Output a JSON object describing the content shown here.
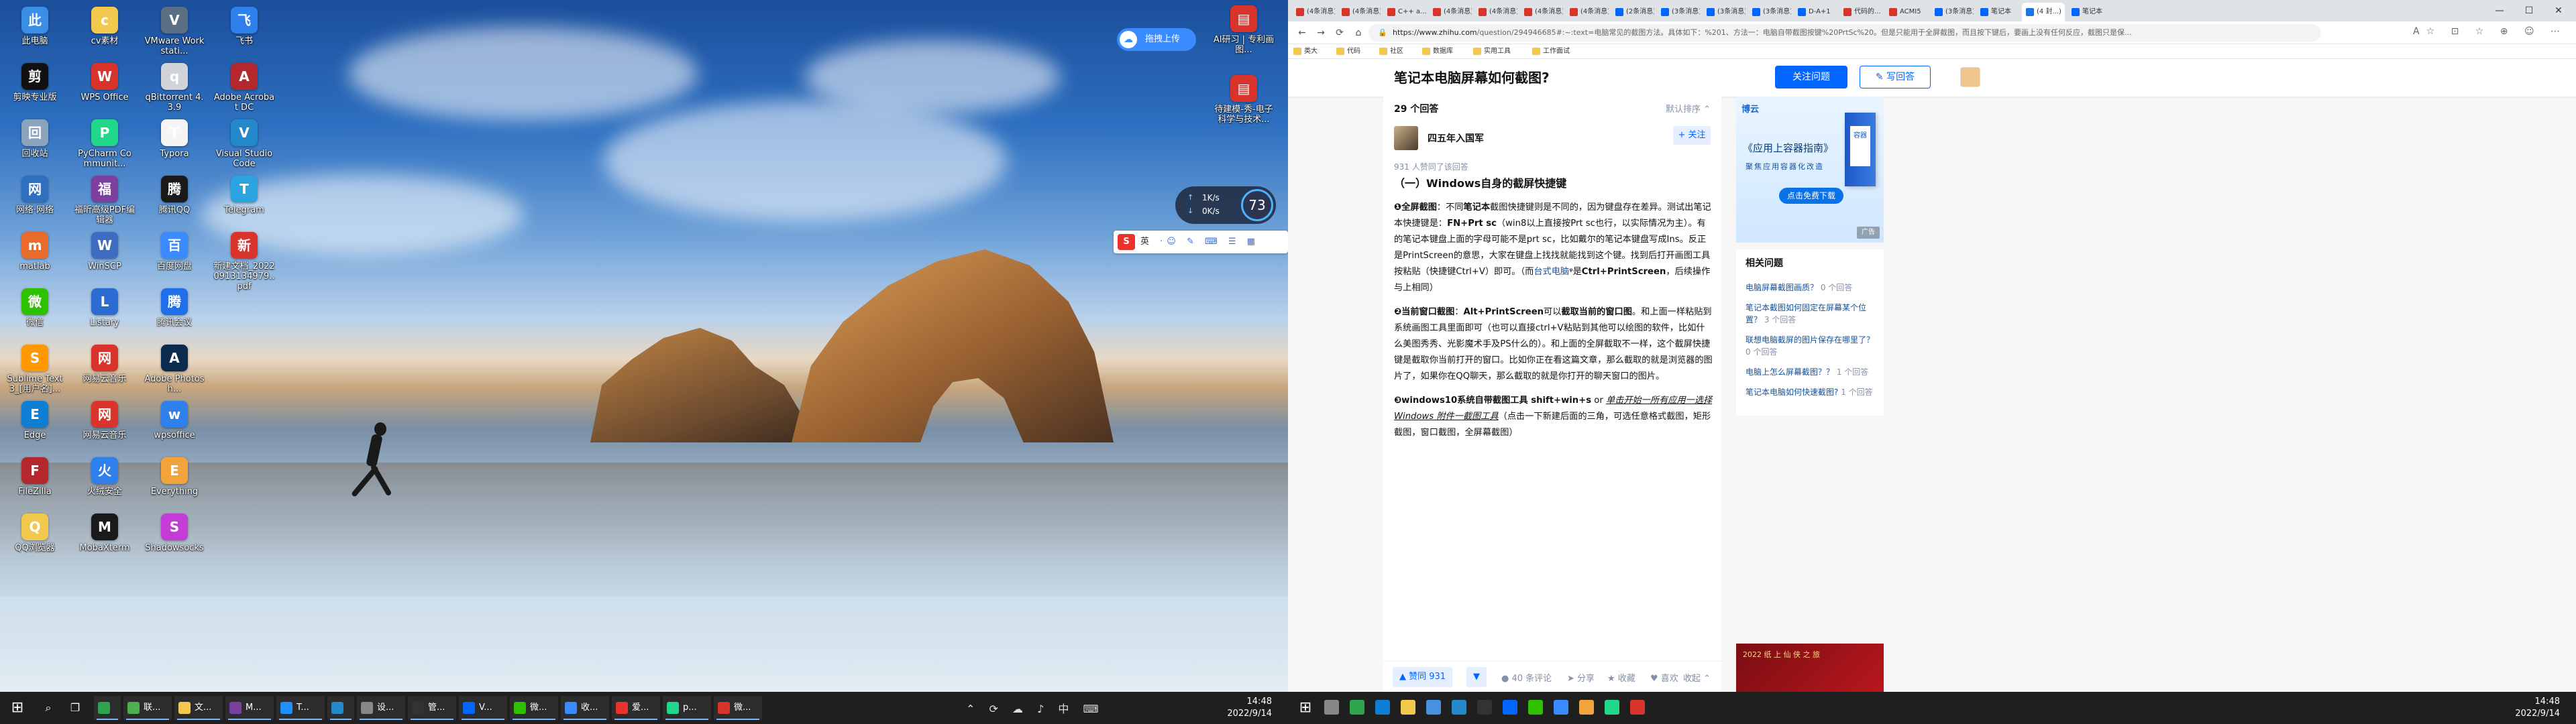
{
  "left_screen": {
    "desktop_icons": [
      {
        "label": "此电脑",
        "icon": "computer-icon",
        "color": "#3a8ee6"
      },
      {
        "label": "cv素材",
        "icon": "folder-icon",
        "color": "#f2c94c"
      },
      {
        "label": "VMware Workstati...",
        "icon": "vmware-icon",
        "color": "#5a6f84"
      },
      {
        "label": "飞书",
        "icon": "feishu-icon",
        "color": "#2f80ed"
      },
      {
        "label": "剪映专业版",
        "icon": "jianying-icon",
        "color": "#111111"
      },
      {
        "label": "WPS Office",
        "icon": "wps-icon",
        "color": "#d8342c"
      },
      {
        "label": "qBittorrent 4.3.9",
        "icon": "qbittorrent-icon",
        "color": "#d0d4d8"
      },
      {
        "label": "Adobe Acrobat DC",
        "icon": "acrobat-icon",
        "color": "#b3282d"
      },
      {
        "label": "回收站",
        "icon": "recycle-bin-icon",
        "color": "#8aa4bd"
      },
      {
        "label": "PyCharm Communit...",
        "icon": "pycharm-icon",
        "color": "#21d789"
      },
      {
        "label": "Typora",
        "icon": "typora-icon",
        "color": "#f5f5f5"
      },
      {
        "label": "Visual Studio Code",
        "icon": "vscode-icon",
        "color": "#2489ca"
      },
      {
        "label": "网络·网络",
        "icon": "network-icon",
        "color": "#2f6fc0"
      },
      {
        "label": "福昕高级PDF编辑器",
        "icon": "foxit-icon",
        "color": "#7b3fa0"
      },
      {
        "label": "腾讯QQ",
        "icon": "qq-icon",
        "color": "#1a1a1a"
      },
      {
        "label": "Telegram",
        "icon": "telegram-icon",
        "color": "#2aa3e0"
      },
      {
        "label": "matlab",
        "icon": "matlab-icon",
        "color": "#e86b2b"
      },
      {
        "label": "WinSCP",
        "icon": "winscp-icon",
        "color": "#3e6cc0"
      },
      {
        "label": "百度网盘",
        "icon": "baidu-netdisk-icon",
        "color": "#3a8bff"
      },
      {
        "label": "新建文档_20220913134979..pdf",
        "icon": "pdf-file-icon",
        "color": "#d8342c"
      },
      {
        "label": "微信",
        "icon": "wechat-icon",
        "color": "#2dc100"
      },
      {
        "label": "Listary",
        "icon": "listary-icon",
        "color": "#2c6bd1"
      },
      {
        "label": "腾讯会议",
        "icon": "tencent-meeting-icon",
        "color": "#1f6feb"
      },
      {
        "label": "",
        "icon": "blank-icon",
        "color": "transparent"
      },
      {
        "label": "Sublime Text 3_[用户名]...",
        "icon": "sublime-icon",
        "color": "#ff9800"
      },
      {
        "label": "网易云音乐",
        "icon": "netease-music-icon",
        "color": "#d8342c"
      },
      {
        "label": "Adobe Photosh...",
        "icon": "photoshop-icon",
        "color": "#0a2b4e"
      },
      {
        "label": "",
        "icon": "blank-icon",
        "color": "transparent"
      },
      {
        "label": "Edge",
        "icon": "edge-icon",
        "color": "#0f7fd6"
      },
      {
        "label": "网易云音乐",
        "icon": "music-icon",
        "color": "#d8342c"
      },
      {
        "label": "wpsoffice",
        "icon": "wps-office-icon",
        "color": "#2f80ed"
      },
      {
        "label": "",
        "icon": "blank-icon",
        "color": "transparent"
      },
      {
        "label": "FileZilla",
        "icon": "filezilla-icon",
        "color": "#b4282d"
      },
      {
        "label": "火绒安全",
        "icon": "huorong-icon",
        "color": "#2f80ed"
      },
      {
        "label": "Everything",
        "icon": "everything-icon",
        "color": "#f2a43a"
      },
      {
        "label": "",
        "icon": "blank-icon",
        "color": "transparent"
      },
      {
        "label": "QQ浏览器",
        "icon": "qq-browser-icon",
        "color": "#f2c94c"
      },
      {
        "label": "MobaXterm",
        "icon": "mobaxterm-icon",
        "color": "#1a1a1a"
      },
      {
        "label": "Shadowsocks",
        "icon": "shadowsocks-icon",
        "color": "#c43bd6"
      }
    ],
    "right_icons": [
      {
        "label": "AI研习 | 专利画图...",
        "icon": "pdf-file-icon",
        "color": "#d8342c"
      },
      {
        "label": "待建模-秀-电子科学与技术...",
        "icon": "pdf-file-icon",
        "color": "#d8342c"
      }
    ],
    "upload_label": "拖拽上传",
    "net_widget": {
      "up": "1K/s",
      "down": "0K/s",
      "cpu": "73"
    },
    "ime_label": "英",
    "ime_tools": "·☺ ✎ ⌨ ☰ ▦",
    "taskbar": {
      "apps": [
        {
          "label": "",
          "color": "#2ea44f"
        },
        {
          "label": "联...",
          "color": "#4caf50"
        },
        {
          "label": "文...",
          "color": "#f2c94c"
        },
        {
          "label": "M...",
          "color": "#7b3fa0"
        },
        {
          "label": "T...",
          "color": "#1e90ff"
        },
        {
          "label": "",
          "color": "#2489ca"
        },
        {
          "label": "设...",
          "color": "#888888"
        },
        {
          "label": "管...",
          "color": "#333333"
        },
        {
          "label": "V...",
          "color": "#0066ff"
        },
        {
          "label": "微...",
          "color": "#2dc100"
        },
        {
          "label": "收...",
          "color": "#3a8bff"
        },
        {
          "label": "爱...",
          "color": "#e8322b"
        },
        {
          "label": "p...",
          "color": "#21d789"
        },
        {
          "label": "微...",
          "color": "#d8342c"
        }
      ],
      "time": "14:48",
      "date": "2022/9/14",
      "tray": "⌃ ⟳ ☁ ♪ 中 ⌨"
    }
  },
  "right_screen": {
    "tabs": [
      {
        "label": "(4条消息)",
        "color": "#d8342c"
      },
      {
        "label": "(4条消息)",
        "color": "#d8342c"
      },
      {
        "label": "C++ a...",
        "color": "#d8342c"
      },
      {
        "label": "(4条消息)",
        "color": "#d8342c"
      },
      {
        "label": "(4条消息)",
        "color": "#d8342c"
      },
      {
        "label": "(4条消息)",
        "color": "#d8342c"
      },
      {
        "label": "(4条消息)",
        "color": "#d8342c"
      },
      {
        "label": "(2条消息)",
        "color": "#0066ff"
      },
      {
        "label": "(3条消息)",
        "color": "#0066ff"
      },
      {
        "label": "(3条消息)",
        "color": "#0066ff"
      },
      {
        "label": "(3条消息)",
        "color": "#0066ff"
      },
      {
        "label": "D-A+1",
        "color": "#0066ff"
      },
      {
        "label": "代码的...",
        "color": "#d8342c"
      },
      {
        "label": "ACMI5",
        "color": "#d8342c"
      },
      {
        "label": "(3条消息)",
        "color": "#0066ff"
      },
      {
        "label": "笔记本",
        "color": "#0066ff"
      },
      {
        "label": "(4 封...)",
        "color": "#1a73e8"
      },
      {
        "label": "笔记本",
        "color": "#0066ff"
      }
    ],
    "window_controls": {
      "min": "—",
      "max": "☐",
      "close": "✕"
    },
    "url_host": "https://www.zhihu.com",
    "url_path": "/question/294946685#:~:text=电脑常见的截图方法。具体如下：%201、方法一：电脑自带截图按键%20PrtSc%20。但是只能用于全屏截图，而且按下键后，要画上没有任何反应，截图只是保...",
    "nav": {
      "back": "←",
      "forward": "→",
      "reload": "⟳",
      "home": "⌂"
    },
    "ext_icons": "A☆ ⊡ ☆ ⊕ ☺ ⋯",
    "bookmarks": [
      "类大",
      "代码",
      "社区",
      "数据库",
      "实用工具",
      "工作面试"
    ],
    "question_title": "笔记本电脑屏幕如何截图?",
    "follow_question": "关注问题",
    "write_answer": "✎ 写回答",
    "answers_count": "29 个回答",
    "sort_label": "默认排序 ⌃",
    "author_name": "四五年入国军",
    "author_follow": "+ 关注",
    "agree_text": "931 人赞同了该回答",
    "section_heading": "（一）Windows自身的截屏快捷键",
    "vote_up": "▲ 赞同 931",
    "vote_down": "▼",
    "actions": {
      "comments": "● 40 条评论",
      "share": "➤ 分享",
      "fav": "★ 收藏",
      "like": "♥ 喜欢",
      "more": "⋯"
    },
    "collapse": "收起 ⌃",
    "ad": {
      "logo": "博云",
      "title": "《应用上容器指南》",
      "sub": "聚焦应用容器化改造",
      "book": "容器",
      "btn": "点击免费下载",
      "tag": "广告"
    },
    "related_heading": "相关问题",
    "related": [
      {
        "q": "电脑屏幕截图画质？",
        "n": "0 个回答"
      },
      {
        "q": "笔记本截图如何固定在屏幕某个位置？",
        "n": "3 个回答"
      },
      {
        "q": "联想电脑截屏的图片保存在哪里了？",
        "n": "0 个回答"
      },
      {
        "q": "电脑上怎么屏幕截图？？",
        "n": "1 个回答"
      },
      {
        "q": "笔记本电脑如何快速截图?",
        "n": "1 个回答"
      }
    ],
    "ad2_text": "2022 纸 上 仙 侠 之 旅",
    "taskbar": {
      "time": "14:48",
      "date": "2022/9/14"
    }
  }
}
